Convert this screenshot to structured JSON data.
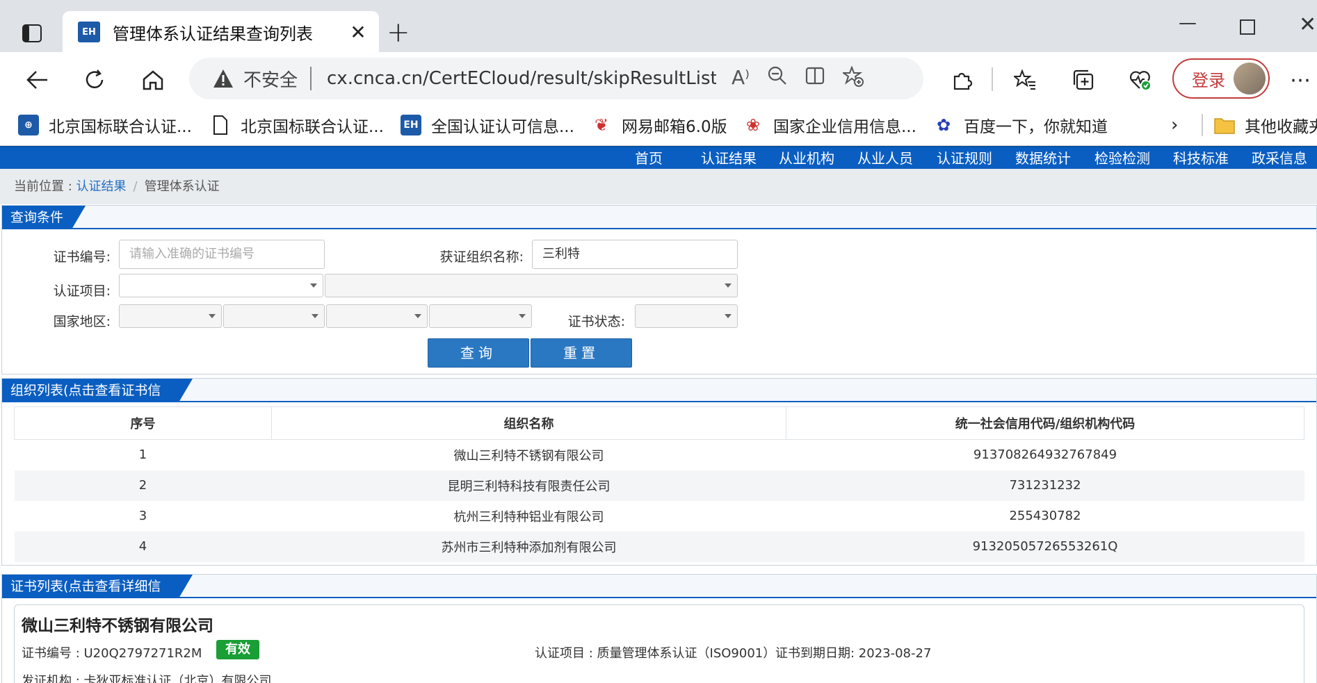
{
  "browser": {
    "tab_title": "管理体系认证结果查询列表",
    "tab_favicon_text": "EH",
    "insecure_label": "不安全",
    "url": "cx.cnca.cn/CertECloud/result/skipResultList?cer...",
    "login_label": "登录"
  },
  "bookmarks": [
    {
      "label": "北京国标联合认证...",
      "icon": "cert-logo-icon"
    },
    {
      "label": "北京国标联合认证...",
      "icon": "page-icon"
    },
    {
      "label": "全国认证认可信息...",
      "icon": "cnca-icon"
    },
    {
      "label": "网易邮箱6.0版",
      "icon": "netease-icon"
    },
    {
      "label": "国家企业信用信息...",
      "icon": "huawei-icon"
    },
    {
      "label": "百度一下，你就知道",
      "icon": "baidu-icon"
    },
    {
      "label": "其他收藏夹",
      "icon": "folder-icon"
    }
  ],
  "site_nav": [
    "首页",
    "认证结果",
    "从业机构",
    "从业人员",
    "认证规则",
    "数据统计",
    "检验检测",
    "科技标准",
    "政采信息"
  ],
  "breadcrumb": {
    "prefix": "当前位置 : ",
    "link": "认证结果",
    "current": "管理体系认证"
  },
  "query": {
    "title": "查询条件",
    "cert_no_label": "证书编号:",
    "cert_no_placeholder": "请输入准确的证书编号",
    "org_name_label": "获证组织名称:",
    "org_name_value": "三利特",
    "project_label": "认证项目:",
    "region_label": "国家地区:",
    "status_label": "证书状态:",
    "search_btn": "查询",
    "reset_btn": "重置"
  },
  "org_list": {
    "title": "组织列表(点击查看证书信息)",
    "headers": [
      "序号",
      "组织名称",
      "统一社会信用代码/组织机构代码"
    ],
    "rows": [
      [
        "1",
        "微山三利特不锈钢有限公司",
        "913708264932767849"
      ],
      [
        "2",
        "昆明三利特科技有限责任公司",
        "731231232"
      ],
      [
        "3",
        "杭州三利特种铝业有限公司",
        "255430782"
      ],
      [
        "4",
        "苏州市三利特种添加剂有限公司",
        "91320505726553261Q"
      ]
    ]
  },
  "cert_list": {
    "title": "证书列表(点击查看详细信息)",
    "org_name": "微山三利特不锈钢有限公司",
    "cert_no": "证书编号 : U20Q2797271R2M",
    "status": "有效",
    "project": "认证项目 : 质量管理体系认证（ISO9001）",
    "expiry": "证书到期日期: 2023-08-27",
    "issuer": "发证机构 : 卡狄亚标准认证（北京）有限公司"
  },
  "colors": {
    "brand_blue": "#0a5ec1",
    "button_blue": "#2b78c2",
    "valid_green": "#1a9e36",
    "login_red": "#c43a3a"
  }
}
